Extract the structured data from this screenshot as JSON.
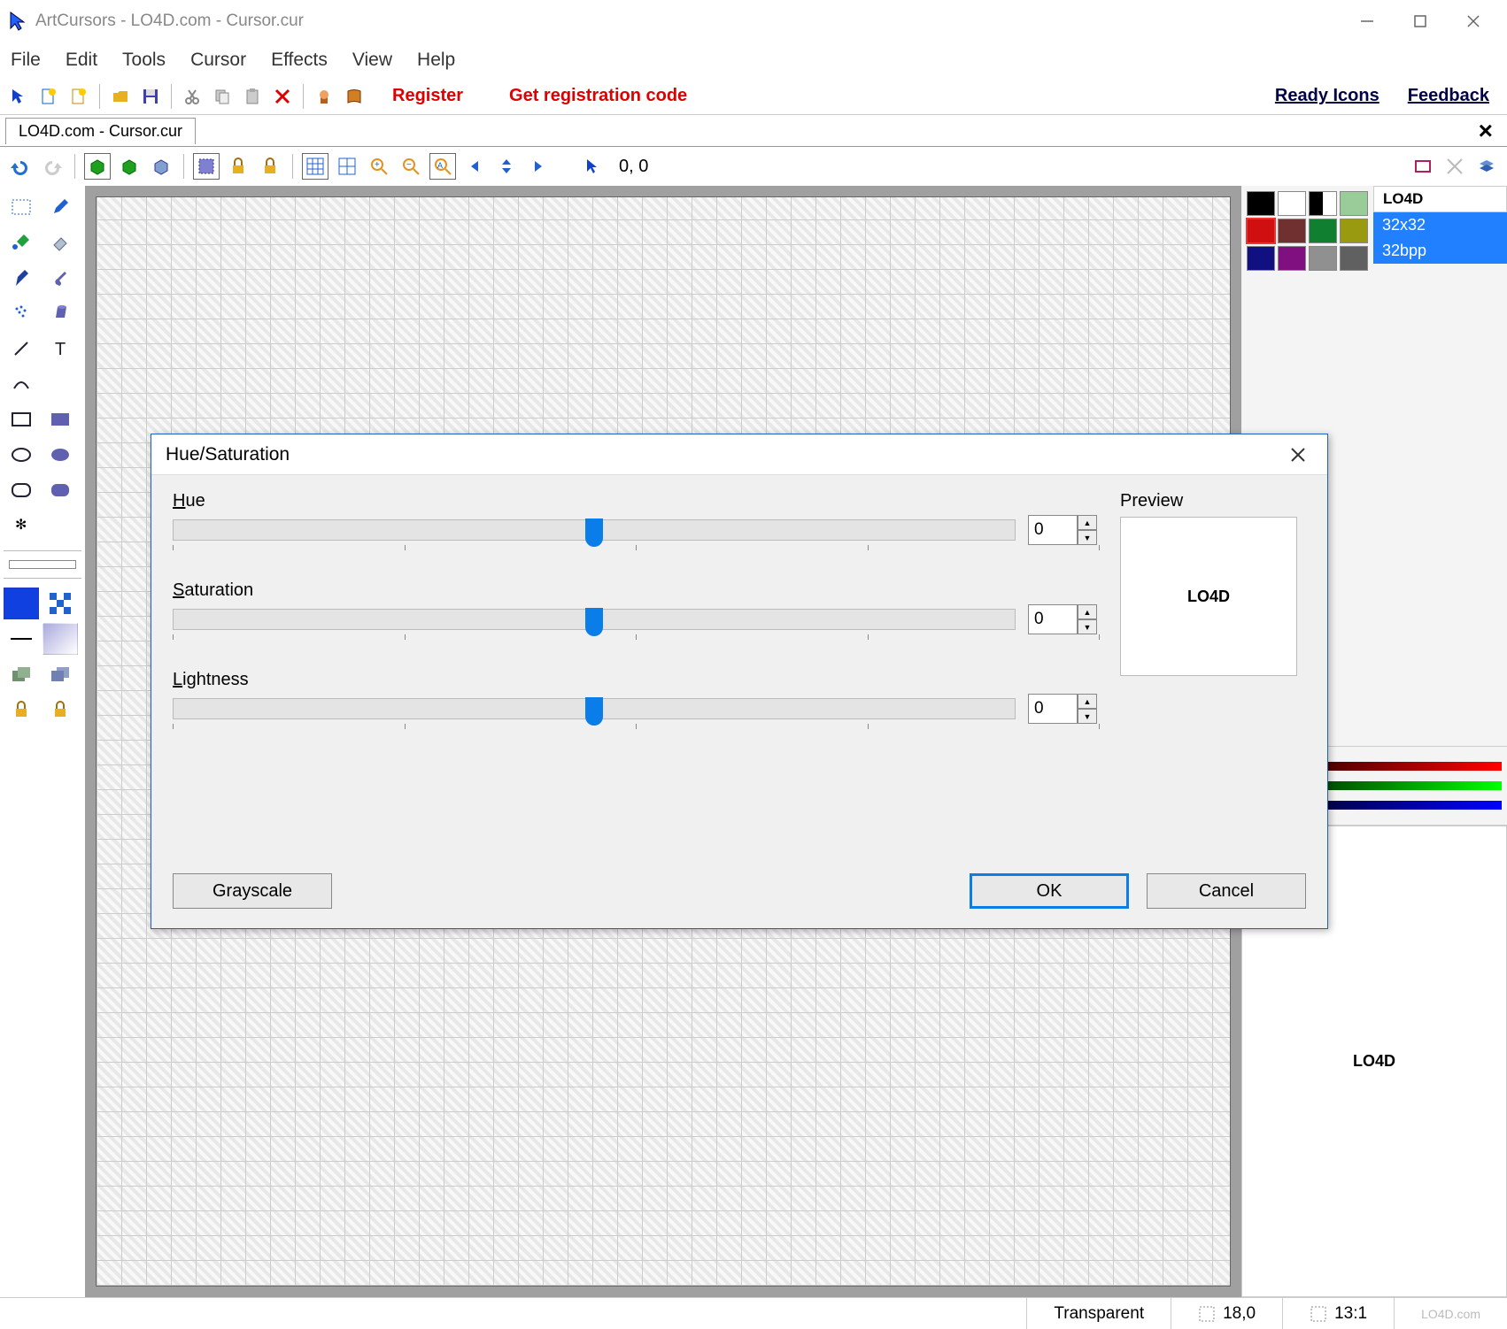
{
  "window": {
    "title": "ArtCursors - LO4D.com - Cursor.cur"
  },
  "menus": [
    "File",
    "Edit",
    "Tools",
    "Cursor",
    "Effects",
    "View",
    "Help"
  ],
  "toolbar": {
    "register": "Register",
    "getcode": "Get registration code",
    "readyicons": "Ready Icons",
    "feedback": "Feedback"
  },
  "doctab": "LO4D.com - Cursor.cur",
  "coords": "0, 0",
  "formats": {
    "head": "LO4D",
    "size": "32x32",
    "bpp": "32bpp"
  },
  "palette": [
    "#000000",
    "#ffffff",
    "#000000",
    "#55aa55",
    "#d01010",
    "#703030",
    "#108030",
    "#9a9a10",
    "#101080",
    "#801080",
    "#909090",
    "#606060"
  ],
  "dialog": {
    "title": "Hue/Saturation",
    "hue_label": "Hue",
    "sat_label": "Saturation",
    "light_label": "Lightness",
    "hue_val": "0",
    "sat_val": "0",
    "light_val": "0",
    "grayscale": "Grayscale",
    "ok": "OK",
    "cancel": "Cancel",
    "preview": "Preview",
    "preview_text": "LO4D"
  },
  "status": {
    "transparent": "Transparent",
    "pos": "18,0",
    "zoom": "13:1"
  },
  "preview2_text": "LO4D",
  "watermark": "LO4D.com"
}
